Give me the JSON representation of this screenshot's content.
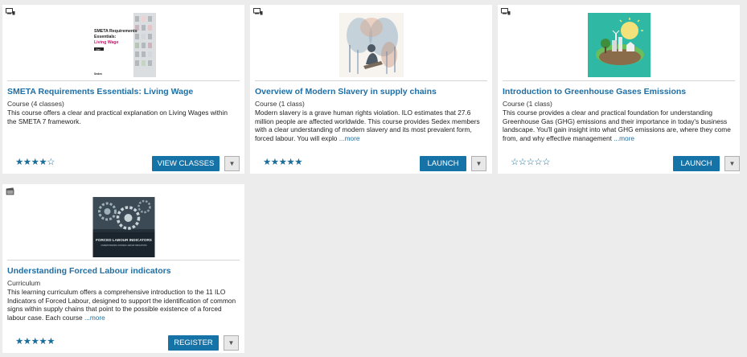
{
  "cards": [
    {
      "title": "SMETA Requirements Essentials: Living Wage",
      "subtitle": "Course (4 classes)",
      "description": "This course offers a clear and practical explanation on Living Wages within the SMETA 7 framework.",
      "more": "",
      "rating_stars": "★★★★☆",
      "rating": 4,
      "button": "VIEW CLASSES",
      "thumb_text": {
        "line1": "SMETA Requirements",
        "line2": "Essentials:",
        "line3": "Living Wage",
        "tag": "Start",
        "brand": "Sedex"
      }
    },
    {
      "title": "Overview of Modern Slavery in supply chains",
      "subtitle": "Course (1 class)",
      "description": "Modern slavery is a grave human rights violation. ILO estimates that 27.6 million people are affected worldwide.     This course provides Sedex members with a clear understanding of modern slavery and its most prevalent form, forced labour. You will explo",
      "more": "...more",
      "rating_stars": "★★★★★",
      "rating": 5,
      "button": "LAUNCH"
    },
    {
      "title": "Introduction to Greenhouse Gases Emissions",
      "subtitle": "Course (1 class)",
      "description": "This course provides a clear and practical foundation for understanding Greenhouse Gas (GHG) emissions and their importance in today's business landscape. You'll gain insight into what GHG emissions are, where they come from, and why effective management",
      "more": "...more",
      "rating_stars": "☆☆☆☆☆",
      "rating": 0,
      "button": "LAUNCH"
    },
    {
      "title": "Understanding Forced Labour indicators",
      "subtitle": "Curriculum",
      "description": "This learning curriculum offers a comprehensive introduction to the 11 ILO Indicators of Forced Labour, designed to support the identification of common signs within supply chains that point to the possible existence of a forced labour case. Each course",
      "more": "...more",
      "rating_stars": "★★★★★",
      "rating": 5,
      "button": "REGISTER",
      "thumb_text": {
        "line1": "FORCED LABOUR INDICATORS",
        "line2": "UNDERSTANDING FORCED LABOUR INDICATORS"
      }
    }
  ],
  "colors": {
    "accent": "#1673a8",
    "title": "#1d6fa5",
    "background": "#ececec"
  },
  "icons": {
    "course": "course-type-icon",
    "curriculum": "curriculum-type-icon",
    "dropdown": "chevron-down-icon"
  }
}
